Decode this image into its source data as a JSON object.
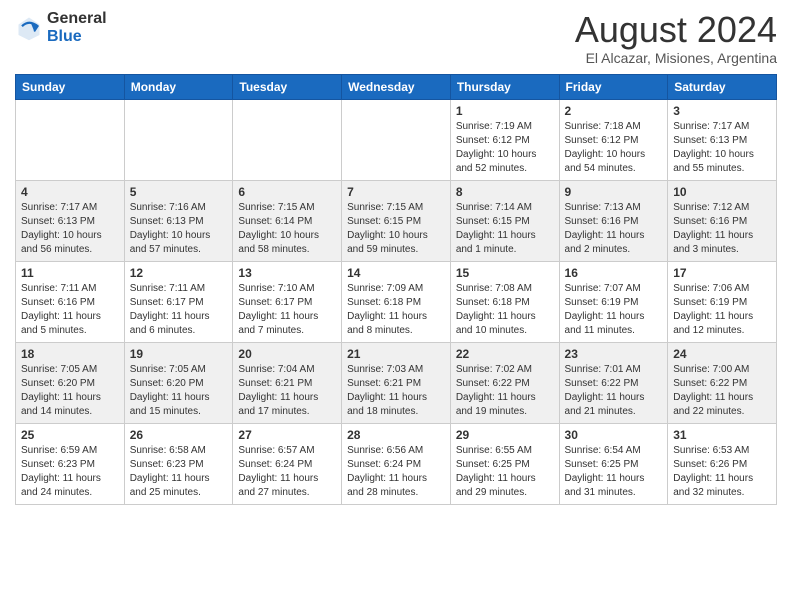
{
  "logo": {
    "general": "General",
    "blue": "Blue"
  },
  "title": "August 2024",
  "subtitle": "El Alcazar, Misiones, Argentina",
  "days_header": [
    "Sunday",
    "Monday",
    "Tuesday",
    "Wednesday",
    "Thursday",
    "Friday",
    "Saturday"
  ],
  "weeks": [
    [
      {
        "day": "",
        "info": ""
      },
      {
        "day": "",
        "info": ""
      },
      {
        "day": "",
        "info": ""
      },
      {
        "day": "",
        "info": ""
      },
      {
        "day": "1",
        "info": "Sunrise: 7:19 AM\nSunset: 6:12 PM\nDaylight: 10 hours\nand 52 minutes."
      },
      {
        "day": "2",
        "info": "Sunrise: 7:18 AM\nSunset: 6:12 PM\nDaylight: 10 hours\nand 54 minutes."
      },
      {
        "day": "3",
        "info": "Sunrise: 7:17 AM\nSunset: 6:13 PM\nDaylight: 10 hours\nand 55 minutes."
      }
    ],
    [
      {
        "day": "4",
        "info": "Sunrise: 7:17 AM\nSunset: 6:13 PM\nDaylight: 10 hours\nand 56 minutes."
      },
      {
        "day": "5",
        "info": "Sunrise: 7:16 AM\nSunset: 6:13 PM\nDaylight: 10 hours\nand 57 minutes."
      },
      {
        "day": "6",
        "info": "Sunrise: 7:15 AM\nSunset: 6:14 PM\nDaylight: 10 hours\nand 58 minutes."
      },
      {
        "day": "7",
        "info": "Sunrise: 7:15 AM\nSunset: 6:15 PM\nDaylight: 10 hours\nand 59 minutes."
      },
      {
        "day": "8",
        "info": "Sunrise: 7:14 AM\nSunset: 6:15 PM\nDaylight: 11 hours\nand 1 minute."
      },
      {
        "day": "9",
        "info": "Sunrise: 7:13 AM\nSunset: 6:16 PM\nDaylight: 11 hours\nand 2 minutes."
      },
      {
        "day": "10",
        "info": "Sunrise: 7:12 AM\nSunset: 6:16 PM\nDaylight: 11 hours\nand 3 minutes."
      }
    ],
    [
      {
        "day": "11",
        "info": "Sunrise: 7:11 AM\nSunset: 6:16 PM\nDaylight: 11 hours\nand 5 minutes."
      },
      {
        "day": "12",
        "info": "Sunrise: 7:11 AM\nSunset: 6:17 PM\nDaylight: 11 hours\nand 6 minutes."
      },
      {
        "day": "13",
        "info": "Sunrise: 7:10 AM\nSunset: 6:17 PM\nDaylight: 11 hours\nand 7 minutes."
      },
      {
        "day": "14",
        "info": "Sunrise: 7:09 AM\nSunset: 6:18 PM\nDaylight: 11 hours\nand 8 minutes."
      },
      {
        "day": "15",
        "info": "Sunrise: 7:08 AM\nSunset: 6:18 PM\nDaylight: 11 hours\nand 10 minutes."
      },
      {
        "day": "16",
        "info": "Sunrise: 7:07 AM\nSunset: 6:19 PM\nDaylight: 11 hours\nand 11 minutes."
      },
      {
        "day": "17",
        "info": "Sunrise: 7:06 AM\nSunset: 6:19 PM\nDaylight: 11 hours\nand 12 minutes."
      }
    ],
    [
      {
        "day": "18",
        "info": "Sunrise: 7:05 AM\nSunset: 6:20 PM\nDaylight: 11 hours\nand 14 minutes."
      },
      {
        "day": "19",
        "info": "Sunrise: 7:05 AM\nSunset: 6:20 PM\nDaylight: 11 hours\nand 15 minutes."
      },
      {
        "day": "20",
        "info": "Sunrise: 7:04 AM\nSunset: 6:21 PM\nDaylight: 11 hours\nand 17 minutes."
      },
      {
        "day": "21",
        "info": "Sunrise: 7:03 AM\nSunset: 6:21 PM\nDaylight: 11 hours\nand 18 minutes."
      },
      {
        "day": "22",
        "info": "Sunrise: 7:02 AM\nSunset: 6:22 PM\nDaylight: 11 hours\nand 19 minutes."
      },
      {
        "day": "23",
        "info": "Sunrise: 7:01 AM\nSunset: 6:22 PM\nDaylight: 11 hours\nand 21 minutes."
      },
      {
        "day": "24",
        "info": "Sunrise: 7:00 AM\nSunset: 6:22 PM\nDaylight: 11 hours\nand 22 minutes."
      }
    ],
    [
      {
        "day": "25",
        "info": "Sunrise: 6:59 AM\nSunset: 6:23 PM\nDaylight: 11 hours\nand 24 minutes."
      },
      {
        "day": "26",
        "info": "Sunrise: 6:58 AM\nSunset: 6:23 PM\nDaylight: 11 hours\nand 25 minutes."
      },
      {
        "day": "27",
        "info": "Sunrise: 6:57 AM\nSunset: 6:24 PM\nDaylight: 11 hours\nand 27 minutes."
      },
      {
        "day": "28",
        "info": "Sunrise: 6:56 AM\nSunset: 6:24 PM\nDaylight: 11 hours\nand 28 minutes."
      },
      {
        "day": "29",
        "info": "Sunrise: 6:55 AM\nSunset: 6:25 PM\nDaylight: 11 hours\nand 29 minutes."
      },
      {
        "day": "30",
        "info": "Sunrise: 6:54 AM\nSunset: 6:25 PM\nDaylight: 11 hours\nand 31 minutes."
      },
      {
        "day": "31",
        "info": "Sunrise: 6:53 AM\nSunset: 6:26 PM\nDaylight: 11 hours\nand 32 minutes."
      }
    ]
  ]
}
